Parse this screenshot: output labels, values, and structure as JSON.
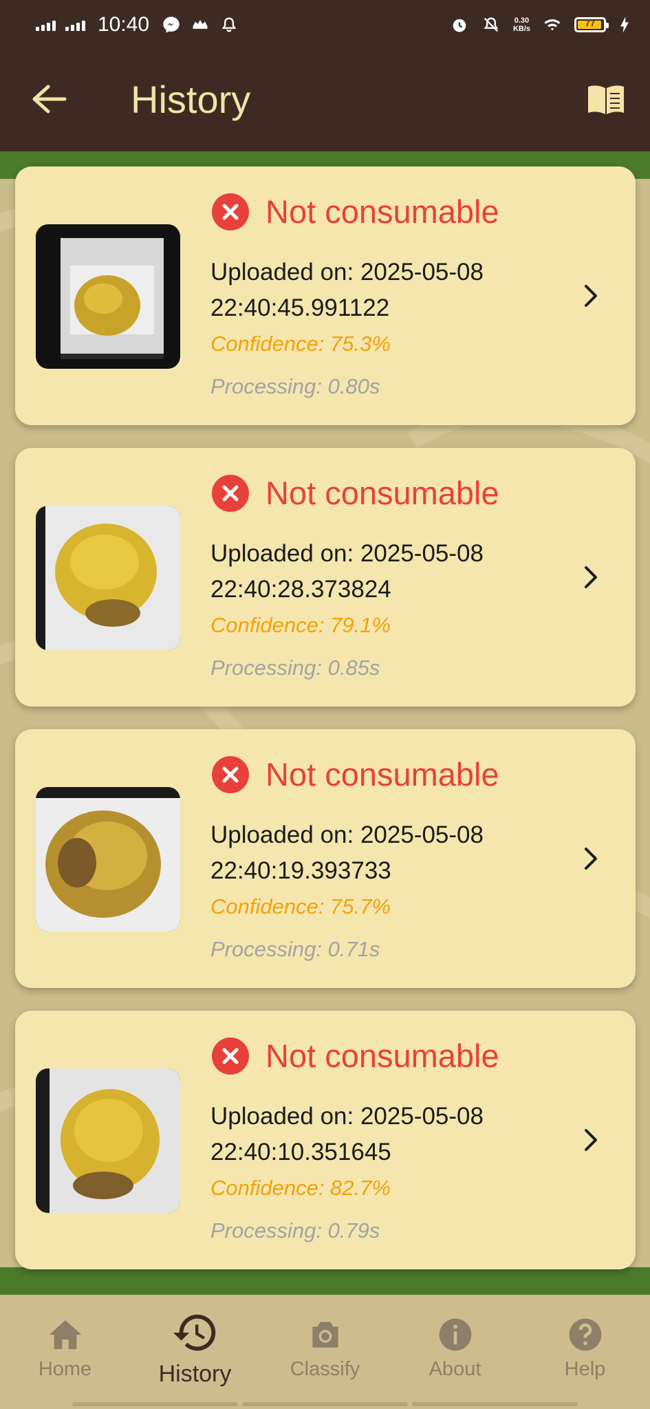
{
  "status_bar": {
    "time": "10:40",
    "network_speed": "0.30",
    "network_unit": "KB/s",
    "battery_level": "77"
  },
  "app_bar": {
    "title": "History",
    "back_icon": "arrow-left-icon",
    "guide_icon": "book-icon"
  },
  "history": [
    {
      "status": "Not consumable",
      "uploaded": "Uploaded on: 2025-05-08 22:40:45.991122",
      "confidence": "Confidence: 75.3%",
      "processing": "Processing: 0.80s"
    },
    {
      "status": "Not consumable",
      "uploaded": "Uploaded on: 2025-05-08 22:40:28.373824",
      "confidence": "Confidence: 79.1%",
      "processing": "Processing: 0.85s"
    },
    {
      "status": "Not consumable",
      "uploaded": "Uploaded on: 2025-05-08 22:40:19.393733",
      "confidence": "Confidence: 75.7%",
      "processing": "Processing: 0.71s"
    },
    {
      "status": "Not consumable",
      "uploaded": "Uploaded on: 2025-05-08 22:40:10.351645",
      "confidence": "Confidence: 82.7%",
      "processing": "Processing: 0.79s"
    }
  ],
  "bottom_nav": {
    "items": [
      {
        "label": "Home",
        "icon": "home-icon"
      },
      {
        "label": "History",
        "icon": "history-icon",
        "active": true
      },
      {
        "label": "Classify",
        "icon": "camera-icon"
      },
      {
        "label": "About",
        "icon": "info-icon"
      },
      {
        "label": "Help",
        "icon": "help-icon"
      }
    ]
  },
  "colors": {
    "app_bar": "#3d2b23",
    "title": "#f4e3a7",
    "card": "#f5e6ae",
    "status_red": "#e8413a",
    "confidence": "#f2a20c",
    "processing": "#a3a3a3",
    "accent_green": "#4a7a2a"
  }
}
